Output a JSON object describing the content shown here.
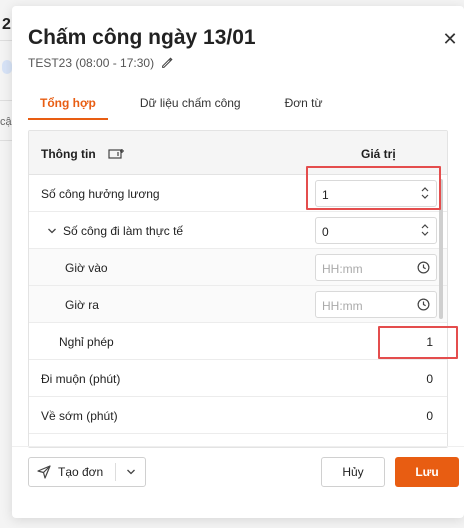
{
  "background": {
    "title_fragment": "2",
    "text_fragment": "cập"
  },
  "modal": {
    "title": "Chấm công ngày 13/01",
    "shift": "TEST23 (08:00 - 17:30)",
    "close_icon": "close-icon",
    "edit_icon": "pencil-icon"
  },
  "tabs": [
    {
      "label": "Tổng hợp",
      "active": true
    },
    {
      "label": "Dữ liệu chấm công",
      "active": false
    },
    {
      "label": "Đơn từ",
      "active": false
    }
  ],
  "table": {
    "header_info": "Thông tin",
    "header_value": "Giá trị",
    "rows": [
      {
        "label": "Số công hưởng lương",
        "value": "1"
      },
      {
        "label": "Số công đi làm thực tế",
        "value": "0"
      },
      {
        "label": "Giờ vào",
        "placeholder": "HH:mm"
      },
      {
        "label": "Giờ ra",
        "placeholder": "HH:mm"
      },
      {
        "label": "Nghỉ phép",
        "value": "1"
      },
      {
        "label": "Đi muộn (phút)",
        "value": "0"
      },
      {
        "label": "Về sớm (phút)",
        "value": "0"
      }
    ]
  },
  "footer": {
    "create_label": "Tạo đơn",
    "cancel_label": "Hủy",
    "save_label": "Lưu"
  },
  "colors": {
    "accent": "#e85d12",
    "highlight": "#e44d4d"
  }
}
